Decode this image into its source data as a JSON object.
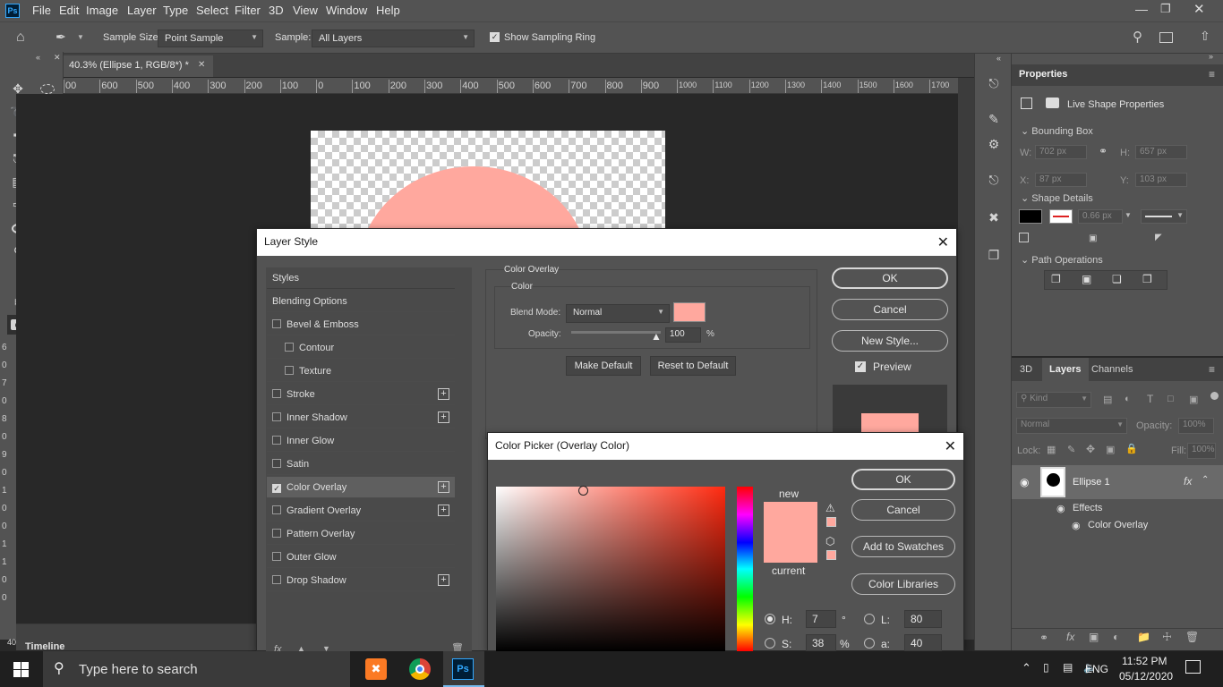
{
  "app": {
    "logo": "Ps"
  },
  "menubar": {
    "items": [
      "File",
      "Edit",
      "Image",
      "Layer",
      "Type",
      "Select",
      "Filter",
      "3D",
      "View",
      "Window",
      "Help"
    ],
    "window_controls": [
      "minimize-icon",
      "restore-icon",
      "close-icon"
    ]
  },
  "options_bar": {
    "sample_size_label": "Sample Size:",
    "sample_size_value": "Point Sample",
    "sample_label": "Sample:",
    "sample_value": "All Layers",
    "show_sampling_ring_label": "Show Sampling Ring",
    "show_sampling_ring_checked": true
  },
  "document": {
    "tab_title": "40.3% (Ellipse 1, RGB/8*) *",
    "ruler_top_ticks": [
      "00",
      "600",
      "500",
      "400",
      "300",
      "200",
      "100",
      "0",
      "100",
      "200",
      "300",
      "400",
      "500",
      "600",
      "700",
      "800",
      "900",
      "1000",
      "1100",
      "1200",
      "1300",
      "1400",
      "1500",
      "1600",
      "1700"
    ],
    "ruler_left_ticks": [
      "6",
      "0",
      "7",
      "0",
      "8",
      "0",
      "9",
      "0",
      "1",
      "0",
      "0",
      "1",
      "1",
      "0",
      "0"
    ],
    "zoom_corner": "40",
    "timeline_label": "Timeline",
    "shape_color": "#ffa89e"
  },
  "toolbox": {
    "foreground_color": "#000000",
    "background_color": "#ffa89e"
  },
  "properties_panel": {
    "title": "Properties",
    "subtitle": "Live Shape Properties",
    "bounding_box": "Bounding Box",
    "w_label": "W:",
    "w_value": "702 px",
    "h_label": "H:",
    "h_value": "657 px",
    "x_label": "X:",
    "x_value": "87 px",
    "y_label": "Y:",
    "y_value": "103 px",
    "shape_details": "Shape Details",
    "stroke_width": "0.66 px",
    "path_operations": "Path Operations"
  },
  "layers_panel": {
    "tabs": [
      "3D",
      "Layers",
      "Channels"
    ],
    "active_tab": "Layers",
    "filter_placeholder": "Kind",
    "blend_mode": "Normal",
    "opacity_label": "Opacity:",
    "opacity_value": "100%",
    "lock_label": "Lock:",
    "fill_label": "Fill:",
    "fill_value": "100%",
    "layer_name": "Ellipse 1",
    "fx_label": "fx",
    "effects_label": "Effects",
    "effect_item": "Color Overlay"
  },
  "layer_style_dialog": {
    "title": "Layer Style",
    "styles_header": "Styles",
    "blending_options": "Blending Options",
    "items": [
      {
        "label": "Bevel & Emboss",
        "checked": false,
        "plus": false,
        "indent": false
      },
      {
        "label": "Contour",
        "checked": false,
        "plus": false,
        "indent": true
      },
      {
        "label": "Texture",
        "checked": false,
        "plus": false,
        "indent": true
      },
      {
        "label": "Stroke",
        "checked": false,
        "plus": true,
        "indent": false
      },
      {
        "label": "Inner Shadow",
        "checked": false,
        "plus": true,
        "indent": false
      },
      {
        "label": "Inner Glow",
        "checked": false,
        "plus": false,
        "indent": false
      },
      {
        "label": "Satin",
        "checked": false,
        "plus": false,
        "indent": false
      },
      {
        "label": "Color Overlay",
        "checked": true,
        "plus": true,
        "indent": false
      },
      {
        "label": "Gradient Overlay",
        "checked": false,
        "plus": true,
        "indent": false
      },
      {
        "label": "Pattern Overlay",
        "checked": false,
        "plus": false,
        "indent": false
      },
      {
        "label": "Outer Glow",
        "checked": false,
        "plus": false,
        "indent": false
      },
      {
        "label": "Drop Shadow",
        "checked": false,
        "plus": true,
        "indent": false
      }
    ],
    "section_title": "Color Overlay",
    "group_title": "Color",
    "blend_mode_label": "Blend Mode:",
    "blend_mode_value": "Normal",
    "overlay_color": "#ffa89e",
    "opacity_label": "Opacity:",
    "opacity_value": "100",
    "opacity_unit": "%",
    "opacity_fraction": 1.0,
    "make_default": "Make Default",
    "reset_default": "Reset to Default",
    "ok": "OK",
    "cancel": "Cancel",
    "new_style": "New Style...",
    "preview_label": "Preview",
    "preview_checked": true
  },
  "color_picker_dialog": {
    "title": "Color Picker (Overlay Color)",
    "ok": "OK",
    "cancel": "Cancel",
    "add_to_swatches": "Add to Swatches",
    "color_libraries": "Color Libraries",
    "new_label": "new",
    "current_label": "current",
    "new_color": "#ffa89e",
    "current_color": "#ffa89e",
    "hue_color": "#ff2a10",
    "h_label": "H:",
    "h_value": "7",
    "h_unit": "°",
    "s_label": "S:",
    "s_value": "38",
    "s_unit": "%",
    "l_label": "L:",
    "l_value": "80",
    "a_label": "a:",
    "a_value": "40"
  },
  "taskbar": {
    "search_placeholder": "Type here to search",
    "language": "ENG",
    "time": "11:52 PM",
    "date": "05/12/2020"
  }
}
